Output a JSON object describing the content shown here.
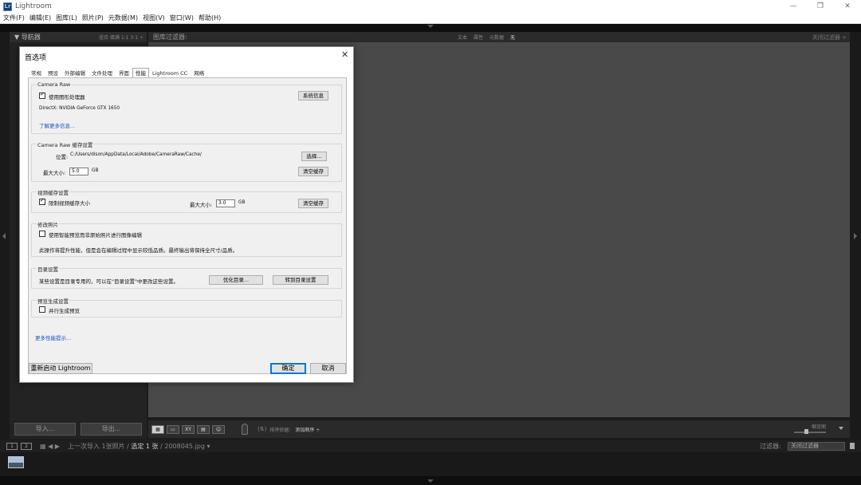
{
  "window": {
    "title": "Lightroom",
    "logo_text": "Lr",
    "controls": [
      "—",
      "❐",
      "✕"
    ]
  },
  "menubar": [
    "文件(F)",
    "编辑(E)",
    "图库(L)",
    "照片(P)",
    "元数据(M)",
    "视图(V)",
    "窗口(W)",
    "帮助(H)"
  ],
  "left_panel": {
    "navigator_title": "▼ 导航器",
    "zoom_opts": "适合 填满 1:1 3:1 ÷"
  },
  "filter_bar": {
    "title": "图库过滤器:",
    "options": [
      "文本",
      "属性",
      "元数据",
      "无"
    ],
    "close": "关闭过滤器 ÷"
  },
  "toolbar": {
    "import": "导入...",
    "export": "导出...",
    "view_modes": [
      "▦",
      "▭",
      "XY",
      "▤",
      "☺"
    ],
    "sort_label": "排序依据:",
    "sort_value": "添加顺序 ÷",
    "thumb_label": "缩览图"
  },
  "filmstrip": {
    "mon1": "1",
    "mon2": "2",
    "nav": "▦  ◀  ▶",
    "source": "上一次导入",
    "count": "1张照片 /",
    "selected": "选定 1 张",
    "file": "/ 2008045.jpg ▾",
    "filter_label": "过滤器:",
    "filter_value": "关闭过滤器"
  },
  "dialog": {
    "title": "首选项",
    "close": "✕",
    "tabs": [
      "常规",
      "预设",
      "外部编辑",
      "文件处理",
      "界面",
      "性能",
      "Lightroom CC",
      "网络"
    ],
    "active_tab": "性能",
    "camera_raw": {
      "title": "Camera Raw",
      "use_gpu": "使用图形处理器",
      "use_gpu_checked": true,
      "system_info": "系统信息",
      "gpu_name": "DirectX: NVIDIA GeForce GTX 1650",
      "learn_more": "了解更多信息..."
    },
    "cache": {
      "title": "Camera Raw 缓存设置",
      "location_label": "位置:",
      "location": "C:/Users/dison/AppData/Local/Adobe/CameraRaw/Cache/",
      "choose": "选择...",
      "max_size_label": "最大大小:",
      "max_size": "5.0",
      "unit": "GB",
      "clear": "清空缓存"
    },
    "video_cache": {
      "title": "视频缓存设置",
      "limit": "限制视频缓存大小",
      "limit_checked": true,
      "max_size_label": "最大大小:",
      "max_size": "3.0",
      "unit": "GB",
      "clear": "清空缓存"
    },
    "develop": {
      "title": "修改照片",
      "smart_preview": "使用智能预览而非原始照片进行图像编辑",
      "smart_preview_checked": false,
      "note": "此操作将提升性能，但是会在编辑过程中显示较低品质。最终输出将保持全尺寸/品质。"
    },
    "catalog": {
      "title": "目录设置",
      "note": "某些设置是目录专用的，可以在\"目录设置\"中更改这些设置。",
      "optimize": "优化目录...",
      "goto": "转到目录设置"
    },
    "preview": {
      "title": "预览生成设置",
      "parallel": "并行生成预览",
      "parallel_checked": false
    },
    "more_tips": "更多性能提示...",
    "restart": "重新启动 Lightroom",
    "ok": "确定",
    "cancel": "取消"
  }
}
